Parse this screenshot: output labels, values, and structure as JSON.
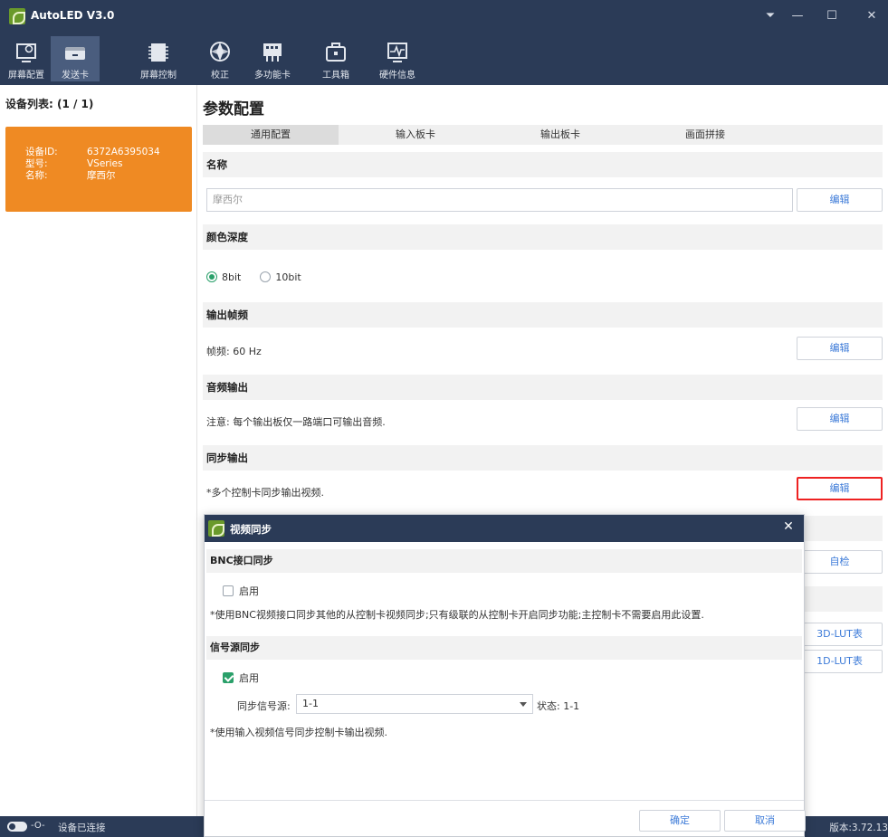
{
  "window": {
    "title": "AutoLED V3.0",
    "controls": {
      "menu": "⏷",
      "minimize": "—",
      "maximize": "☐",
      "close": "✕"
    }
  },
  "toolbar": {
    "items": [
      {
        "label": "屏幕配置",
        "icon": "monitor-gear-icon"
      },
      {
        "label": "发送卡",
        "icon": "sender-card-icon"
      },
      {
        "label": "屏幕控制",
        "icon": "chip-icon"
      },
      {
        "label": "校正",
        "icon": "aperture-icon"
      },
      {
        "label": "多功能卡",
        "icon": "multifunction-card-icon"
      },
      {
        "label": "工具箱",
        "icon": "toolbox-icon"
      },
      {
        "label": "硬件信息",
        "icon": "pulse-monitor-icon"
      }
    ],
    "active": "发送卡"
  },
  "sidebar": {
    "title": "设备列表: (1 / 1)",
    "device": {
      "id_label": "设备ID:",
      "id_value": "6372A6395034",
      "model_label": "型号:",
      "model_value": "VSeries",
      "name_label": "名称:",
      "name_value": "摩西尔"
    }
  },
  "main": {
    "title": "参数配置",
    "tabs": [
      "通用配置",
      "输入板卡",
      "输出板卡",
      "画面拼接"
    ],
    "sections": {
      "name": {
        "title": "名称",
        "input_placeholder": "摩西尔",
        "button": "编辑"
      },
      "color_depth": {
        "title": "颜色深度",
        "options": [
          "8bit",
          "10bit"
        ],
        "selected": "8bit"
      },
      "output_frame": {
        "title": "输出帧频",
        "text": "帧频: 60 Hz",
        "button": "编辑"
      },
      "audio_output": {
        "title": "音频输出",
        "text": "注意: 每个输出板仅一路端口可输出音频.",
        "button": "编辑"
      },
      "sync_output": {
        "title": "同步输出",
        "text": "*多个控制卡同步输出视频.",
        "button": "编辑"
      }
    },
    "hidden_buttons": {
      "self_check": "自检",
      "lut3d": "3D-LUT表",
      "lut1d": "1D-LUT表"
    }
  },
  "dialog": {
    "title": "视频同步",
    "close": "✕",
    "bnc": {
      "title": "BNC接口同步",
      "enable_label": "启用",
      "enabled": false,
      "note": "*使用BNC视频接口同步其他的从控制卡视频同步;只有级联的从控制卡开启同步功能;主控制卡不需要启用此设置."
    },
    "signal": {
      "title": "信号源同步",
      "enable_label": "启用",
      "enabled": true,
      "source_label": "同步信号源:",
      "source_value": "1-1",
      "status": "状态: 1-1",
      "note": "*使用输入视频信号同步控制卡输出视频."
    },
    "ok": "确定",
    "cancel": "取消"
  },
  "statusbar": {
    "connection": "设备已连接",
    "version": "版本:3.72.13"
  }
}
